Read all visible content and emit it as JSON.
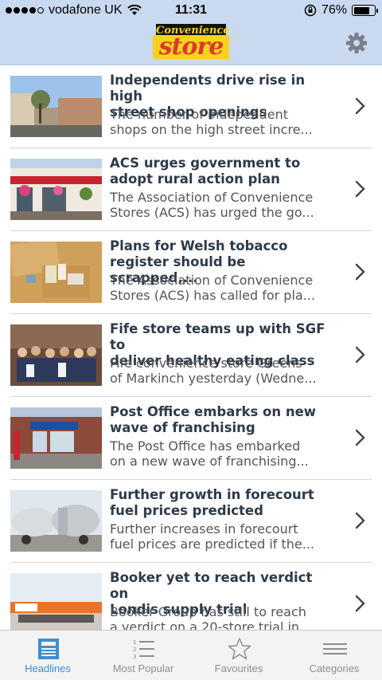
{
  "status_bar": {
    "carrier": "vodafone UK",
    "time": "11:31",
    "battery": "76%",
    "battery_level": 0.76,
    "signal_bars": 4
  },
  "header": {
    "logo_line1": "Convenience",
    "logo_line2": "store",
    "settings_icon": "gear-icon"
  },
  "articles": [
    {
      "title": "Independents drive rise in high\nstreet shop openings",
      "summary": "The number of independent\nshops on the high street incre..."
    },
    {
      "title": "ACS urges government to\nadopt rural action plan",
      "summary": "The Association of Convenience\nStores (ACS) has urged the go..."
    },
    {
      "title": "Plans for Welsh tobacco\nregister should be scrapped,...",
      "summary": "The Association of Convenience\nStores (ACS) has called for pla..."
    },
    {
      "title": "Fife store teams up with SGF to\ndeliver healthy eating class",
      "summary": "Fife convenience store Greens\nof Markinch yesterday (Wedne..."
    },
    {
      "title": "Post Office embarks on new\nwave of franchising",
      "summary": "The Post Office has embarked\non a new wave of franchising..."
    },
    {
      "title": "Further growth in forecourt\nfuel prices predicted",
      "summary": "Further increases in forecourt\nfuel prices are predicted if the..."
    },
    {
      "title": "Booker yet to reach verdict on\nLondis supply trial",
      "summary": "Booker Group has still to reach\na verdict on a 20-store trial in..."
    }
  ],
  "tabs": [
    {
      "label": "Headlines",
      "icon": "newspaper-icon",
      "active": true
    },
    {
      "label": "Most Popular",
      "icon": "numbered-list-icon",
      "active": false
    },
    {
      "label": "Favourites",
      "icon": "star-icon",
      "active": false
    },
    {
      "label": "Categories",
      "icon": "menu-lines-icon",
      "active": false
    }
  ],
  "colors": {
    "nav_background": "#c9d9f0",
    "accent": "#3a8ed4",
    "logo_yellow": "#f7d21d",
    "logo_red": "#d93a2b",
    "title_text": "#2e3a4a"
  }
}
